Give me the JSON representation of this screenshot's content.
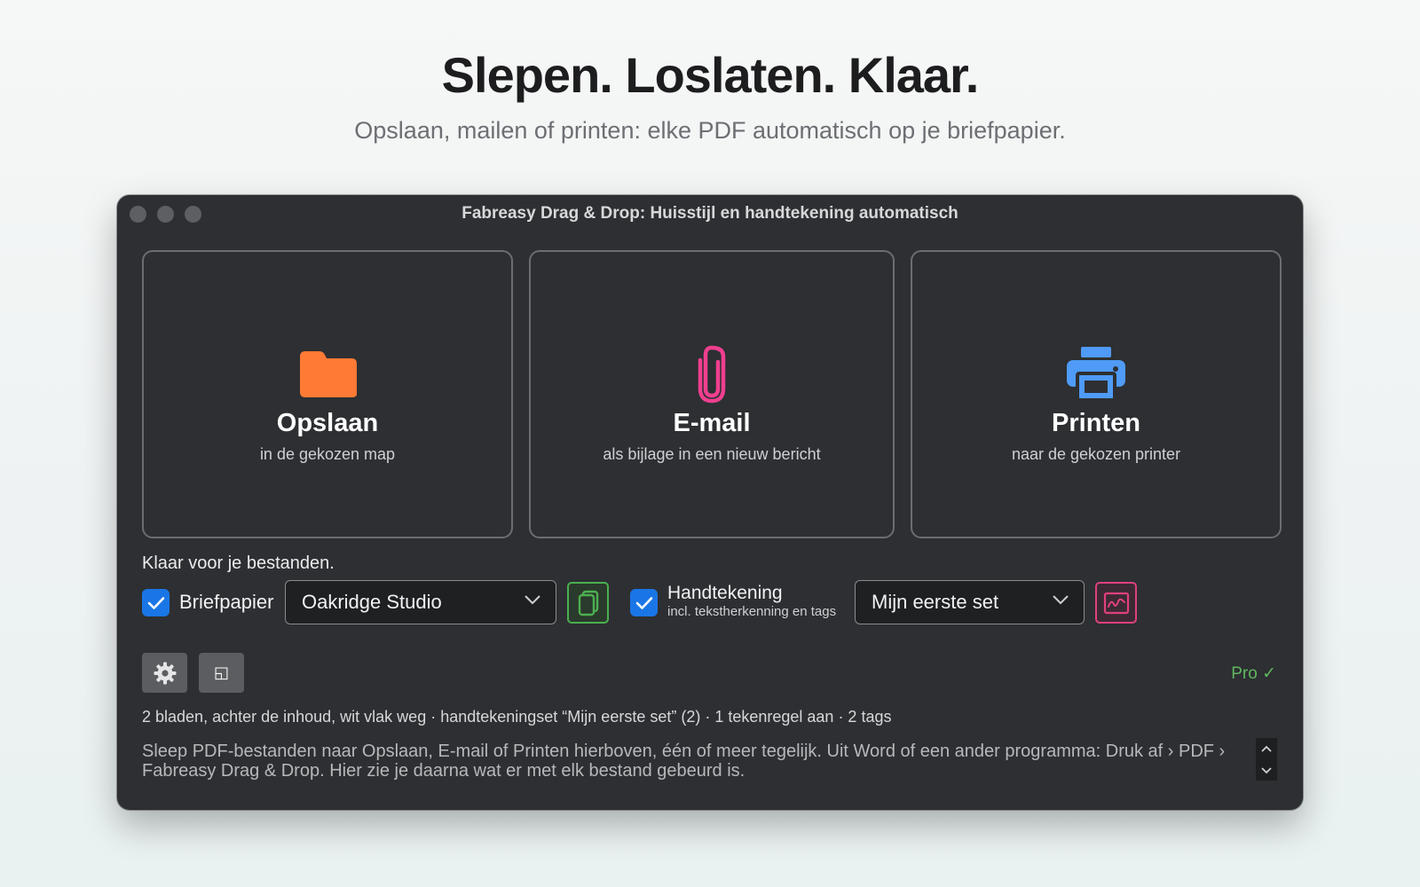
{
  "page": {
    "headline": "Slepen. Loslaten. Klaar.",
    "subline": "Opslaan, mailen of printen: elke PDF automatisch op je briefpapier."
  },
  "window": {
    "title": "Fabreasy Drag & Drop: Huisstijl en handtekening automatisch"
  },
  "zones": {
    "save": {
      "title": "Opslaan",
      "subtitle": "in de gekozen map",
      "icon": "folder-icon",
      "color": "#ff7a35"
    },
    "email": {
      "title": "E-mail",
      "subtitle": "als bijlage in een nieuw bericht",
      "icon": "paperclip-icon",
      "color": "#ef3f8f"
    },
    "print": {
      "title": "Printen",
      "subtitle": "naar de gekozen printer",
      "icon": "printer-icon",
      "color": "#4f9bf7"
    }
  },
  "status": "Klaar voor je bestanden.",
  "letterhead": {
    "checked": true,
    "label": "Briefpapier",
    "selected": "Oakridge Studio",
    "button_icon": "copy-pages-icon",
    "button_color": "#4caf50"
  },
  "signature": {
    "checked": true,
    "label": "Handtekening",
    "sublabel": "incl. tekstherkenning en tags",
    "selected": "Mijn eerste set",
    "button_icon": "signature-icon",
    "button_color": "#e0407f"
  },
  "toolbar": {
    "settings_icon": "gear-icon",
    "window_icon": "window-icon",
    "window_glyph": "◱",
    "pro_label": "Pro ✓"
  },
  "summary": "2 bladen, achter de inhoud, wit vlak weg  ·  handtekeningset “Mijn eerste set” (2)  ·  1 tekenregel aan  ·  2 tags",
  "log": "Sleep PDF-bestanden naar Opslaan, E-mail of Printen hierboven, één of meer tegelijk. Uit Word of een ander programma: Druk af › PDF › Fabreasy Drag & Drop. Hier zie je daarna wat er met elk bestand gebeurd is."
}
